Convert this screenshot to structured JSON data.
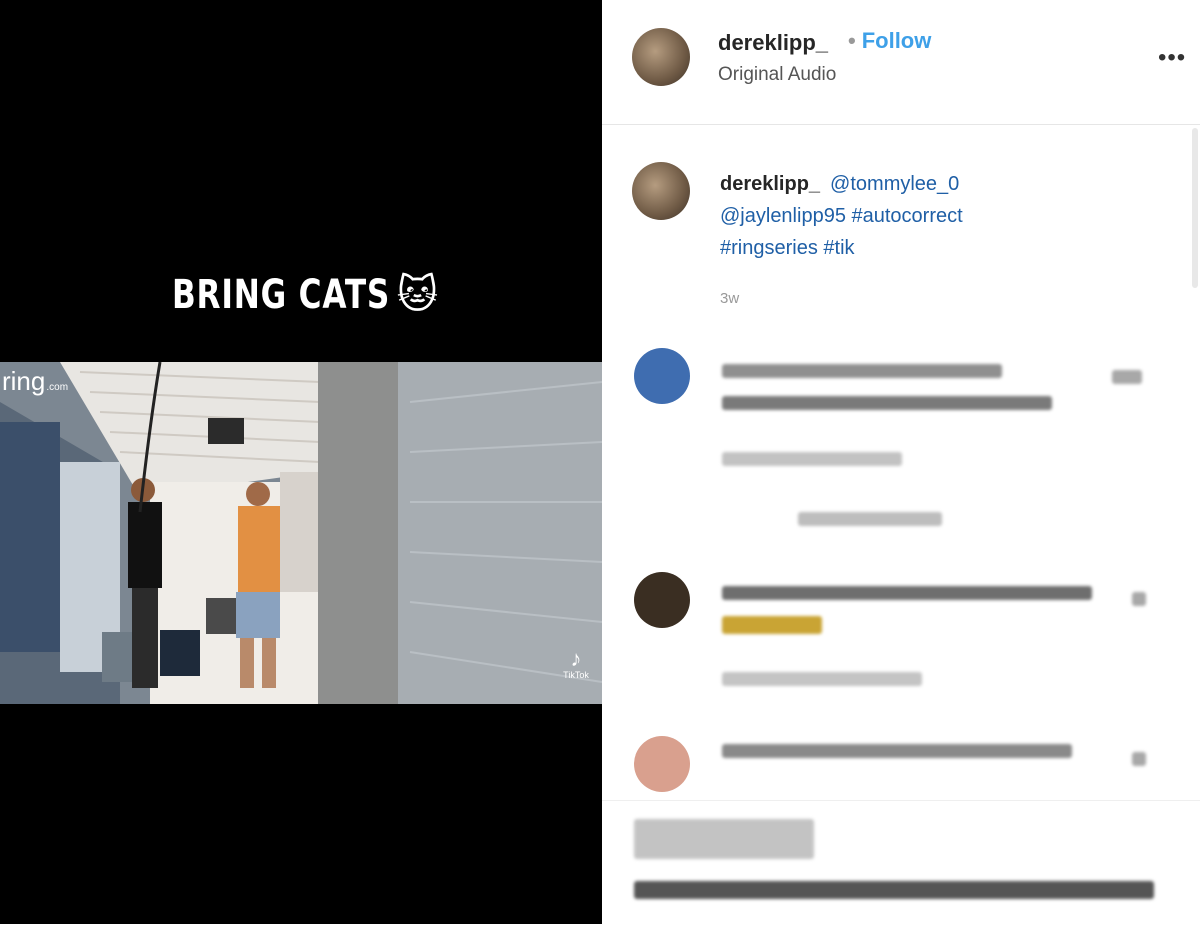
{
  "video": {
    "caption": "BRING CATS",
    "caption_emoji": "🐱",
    "ring_logo": "ring",
    "ring_logo_suffix": ".com",
    "watermark": "TikTok"
  },
  "header": {
    "username": "dereklipp_",
    "follow_label": "Follow",
    "audio": "Original Audio",
    "more": "•••"
  },
  "caption": {
    "username": "dereklipp_",
    "mention1": "@tommylee_0",
    "mention2": "@jaylenlipp95",
    "tag1": "#autocorrect",
    "tag2": "#ringseries",
    "tag3": "#tik",
    "time": "3w"
  },
  "colors": {
    "follow": "#3ea0e8",
    "link": "#1f5fa6"
  },
  "icons": [
    "tiktok-icon",
    "more-icon"
  ]
}
